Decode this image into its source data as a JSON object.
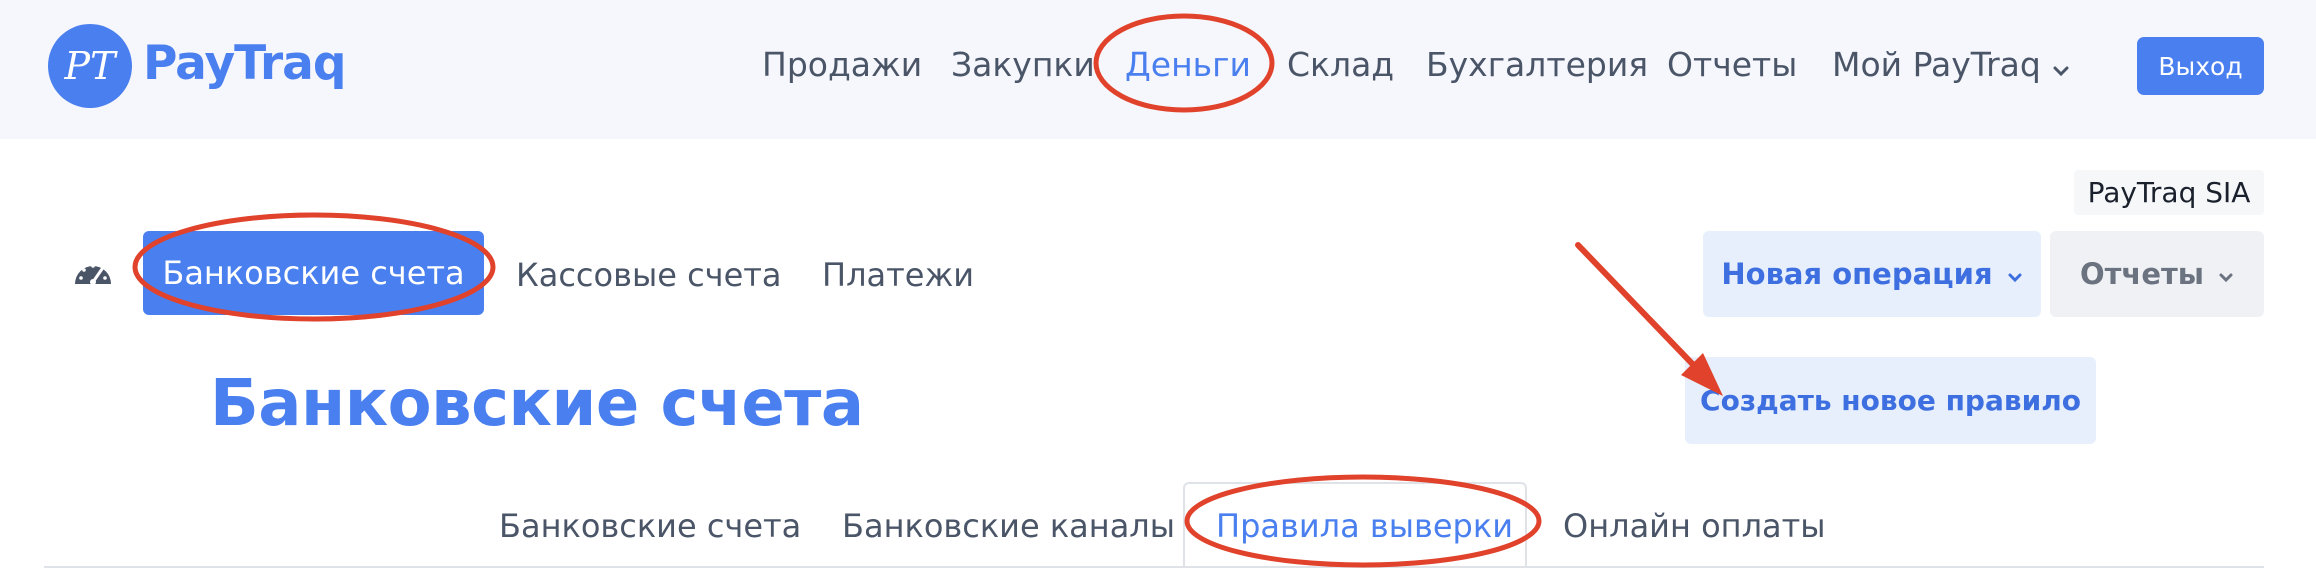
{
  "header": {
    "logo_monogram": "PT",
    "logo_text": "PayTraq",
    "nav": [
      {
        "label": "Продажи",
        "active": false
      },
      {
        "label": "Закупки",
        "active": false
      },
      {
        "label": "Деньги",
        "active": true
      },
      {
        "label": "Склад",
        "active": false
      },
      {
        "label": "Бухгалтерия",
        "active": false
      },
      {
        "label": "Отчеты",
        "active": false
      },
      {
        "label": "Мой PayTraq",
        "active": false,
        "icon": "chevron-down-icon"
      }
    ],
    "logout_label": "Выход"
  },
  "company_name": "PayTraq SIA",
  "subnav": {
    "dashboard_icon": "speedometer-icon",
    "items": [
      {
        "label": "Банковские счета",
        "active": true
      },
      {
        "label": "Кассовые счета",
        "active": false
      },
      {
        "label": "Платежи",
        "active": false
      }
    ]
  },
  "actions": {
    "new_operation_label": "Новая операция",
    "reports_label": "Отчеты",
    "create_rule_label": "Создать новое правило"
  },
  "page_title": "Банковские счета",
  "tabs": [
    {
      "label": "Банковские счета",
      "active": false
    },
    {
      "label": "Банковские каналы",
      "active": false
    },
    {
      "label": "Правила выверки",
      "active": true
    },
    {
      "label": "Онлайн оплаты",
      "active": false
    }
  ],
  "colors": {
    "accent": "#4a7ff0",
    "header_bg": "#f6f7fc",
    "annotation_red": "#e0422b",
    "light_blue_button": "#e7effc"
  }
}
